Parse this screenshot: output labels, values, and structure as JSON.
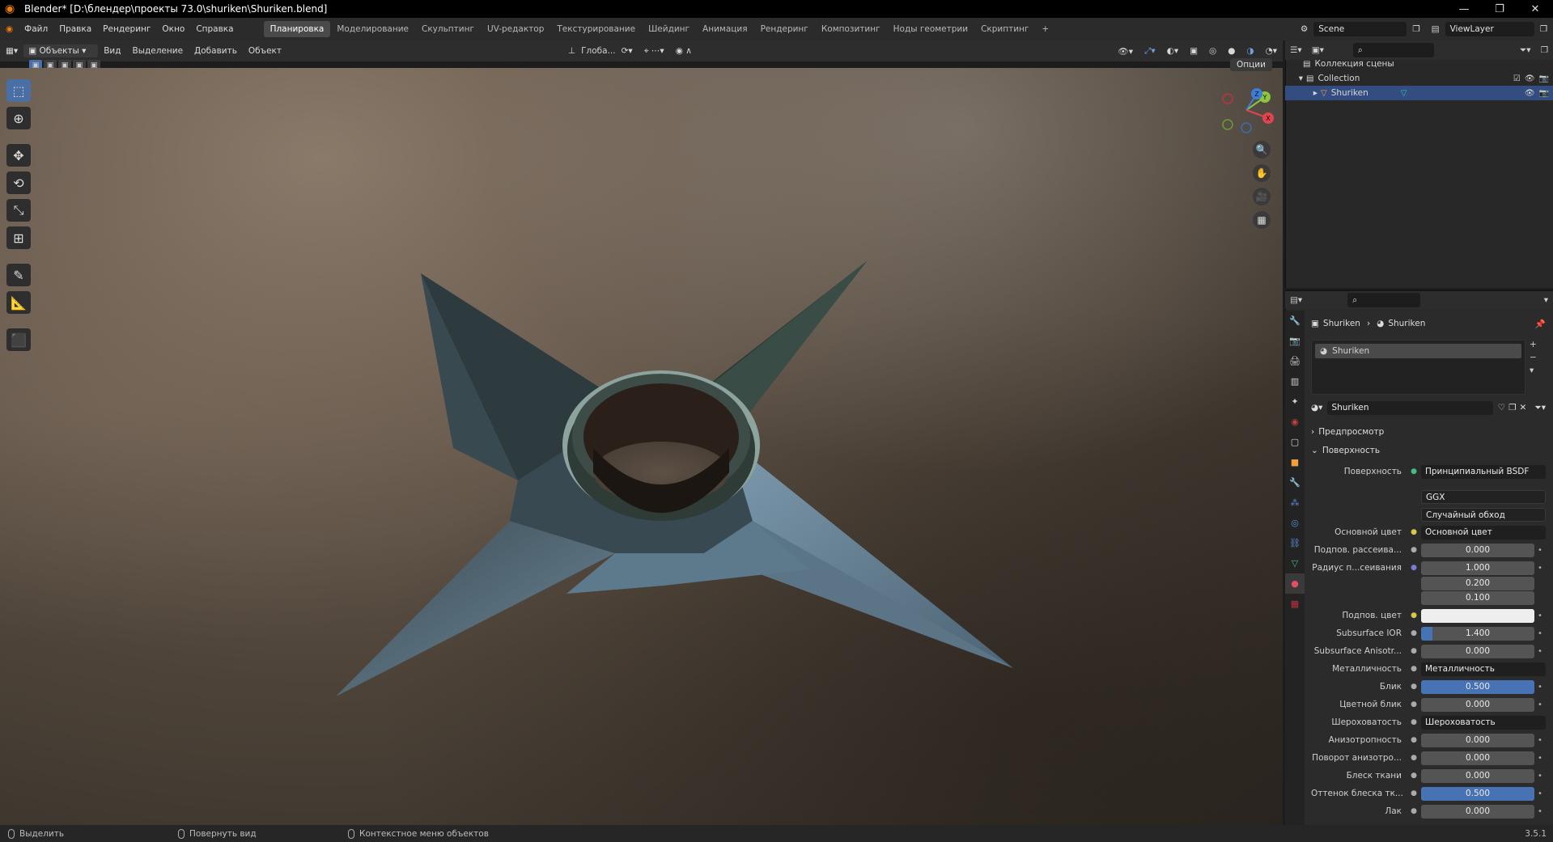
{
  "window": {
    "title": "Blender* [D:\\блендер\\проекты 73.0\\shuriken\\Shuriken.blend]",
    "minimize": "—",
    "maximize": "❐",
    "close": "✕"
  },
  "menu": {
    "items": [
      "Файл",
      "Правка",
      "Рендеринг",
      "Окно",
      "Справка"
    ],
    "workspaces": [
      "Планировка",
      "Моделирование",
      "Скульптинг",
      "UV-редактор",
      "Текстурирование",
      "Шейдинг",
      "Анимация",
      "Рендеринг",
      "Композитинг",
      "Ноды геометрии",
      "Скриптинг"
    ],
    "active_workspace": "Планировка",
    "add_workspace": "+",
    "scene": "Scene",
    "view_layer": "ViewLayer"
  },
  "viewport_header": {
    "mode": "Объекты",
    "items": [
      "Вид",
      "Выделение",
      "Добавить",
      "Объект"
    ],
    "orientation": "Глоба...",
    "options": "Опции"
  },
  "gizmo": {
    "y": "Y",
    "z": "Z",
    "x": "X"
  },
  "outliner": {
    "scene_collection": "Коллекция сцены",
    "collection": "Collection",
    "object": "Shuriken"
  },
  "properties": {
    "breadcrumb_object": "Shuriken",
    "breadcrumb_material": "Shuriken",
    "slot_name": "Shuriken",
    "material_name": "Shuriken",
    "section_preview": "Предпросмотр",
    "section_surface": "Поверхность",
    "rows": {
      "surface": {
        "label": "Поверхность",
        "value": "Принципиальный BSDF"
      },
      "distribution": "GGX",
      "subsurface_method": "Случайный обход",
      "base_color": {
        "label": "Основной цвет",
        "value": "Основной цвет"
      },
      "subsurface": {
        "label": "Подпов. рассеива...",
        "value": "0.000"
      },
      "subsurface_radius": {
        "label": "Радиус п...сеивания",
        "values": [
          "1.000",
          "0.200",
          "0.100"
        ]
      },
      "subsurface_color": {
        "label": "Подпов. цвет"
      },
      "subsurface_ior": {
        "label": "Subsurface IOR",
        "value": "1.400",
        "fill": 0.1
      },
      "subsurface_aniso": {
        "label": "Subsurface Anisotr...",
        "value": "0.000"
      },
      "metallic": {
        "label": "Металличность",
        "value": "Металличность"
      },
      "specular": {
        "label": "Блик",
        "value": "0.500",
        "fill": 1.0
      },
      "specular_tint": {
        "label": "Цветной блик",
        "value": "0.000"
      },
      "roughness": {
        "label": "Шероховатость",
        "value": "Шероховатость"
      },
      "anisotropic": {
        "label": "Анизотропность",
        "value": "0.000"
      },
      "aniso_rotation": {
        "label": "Поворот анизотро...",
        "value": "0.000"
      },
      "sheen": {
        "label": "Блеск ткани",
        "value": "0.000"
      },
      "sheen_tint": {
        "label": "Оттенок блеска тк...",
        "value": "0.500",
        "fill": 1.0
      },
      "clearcoat": {
        "label": "Лак",
        "value": "0.000"
      }
    }
  },
  "statusbar": {
    "select": "Выделить",
    "rotate": "Повернуть вид",
    "context": "Контекстное меню объектов",
    "version": "3.5.1"
  }
}
